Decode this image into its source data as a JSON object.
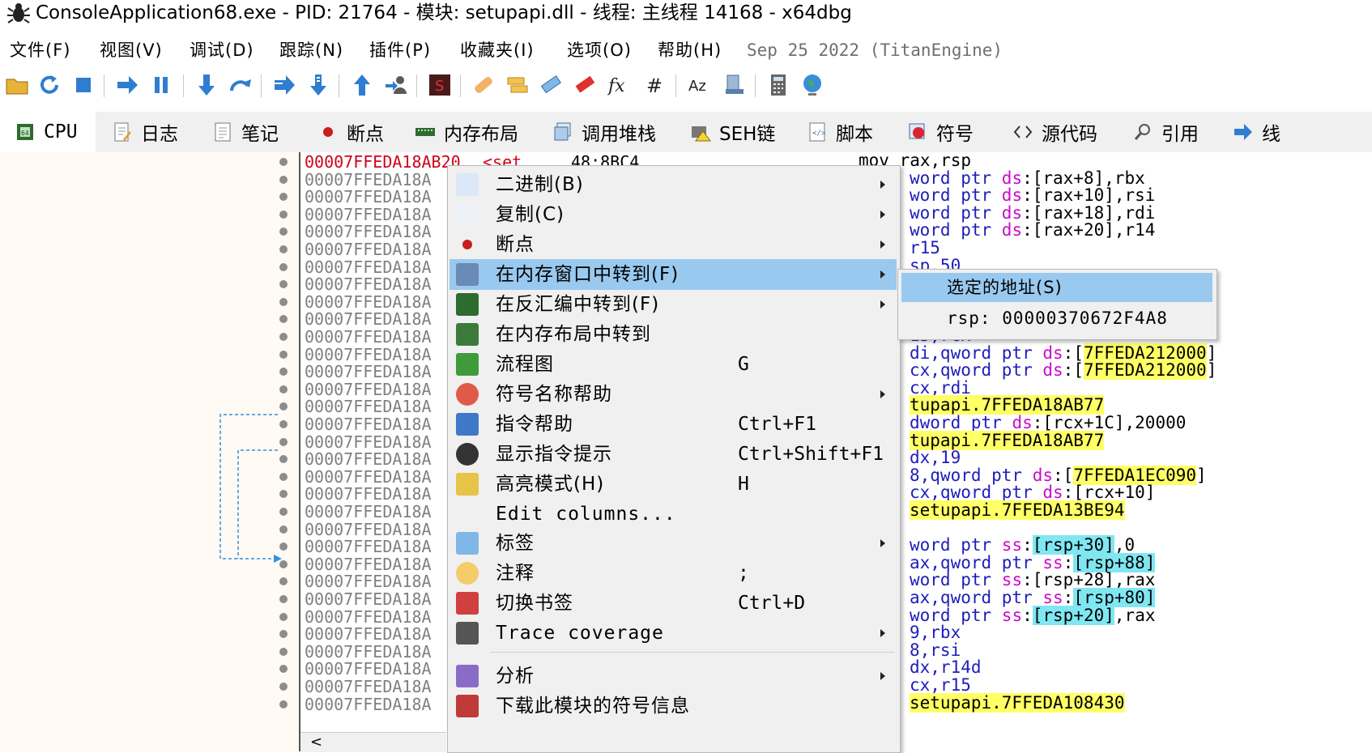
{
  "window": {
    "title": "ConsoleApplication68.exe - PID: 21764 - 模块: setupapi.dll - 线程: 主线程 14168 - x64dbg",
    "app_icon": "bug-icon"
  },
  "menubar": {
    "items": [
      "文件(F)",
      "视图(V)",
      "调试(D)",
      "跟踪(N)",
      "插件(P)",
      "收藏夹(I)",
      "选项(O)",
      "帮助(H)"
    ],
    "build_info": "Sep 25 2022 (TitanEngine)"
  },
  "toolbar": {
    "icons": [
      "open-icon",
      "restart-icon",
      "stop-icon",
      "run-icon",
      "pause-icon",
      "step-into-icon",
      "step-over-icon",
      "trace-into-icon",
      "trace-over-icon",
      "execute-till-return-icon",
      "run-to-user-code-icon",
      "scylla-icon",
      "patch-icon",
      "comment-icon",
      "label-icon",
      "bookmark-icon",
      "function-icon",
      "hash-icon",
      "font-icon",
      "calculator-icon",
      "memory-icon",
      "globe-icon"
    ]
  },
  "tabs": [
    {
      "label": "CPU",
      "icon": "cpu-icon",
      "active": true
    },
    {
      "label": "日志",
      "icon": "log-icon"
    },
    {
      "label": "笔记",
      "icon": "notes-icon"
    },
    {
      "label": "断点",
      "icon": "breakpoint-icon"
    },
    {
      "label": "内存布局",
      "icon": "memory-map-icon"
    },
    {
      "label": "调用堆栈",
      "icon": "call-stack-icon"
    },
    {
      "label": "SEH链",
      "icon": "seh-icon"
    },
    {
      "label": "脚本",
      "icon": "script-icon"
    },
    {
      "label": "符号",
      "icon": "symbols-icon"
    },
    {
      "label": "源代码",
      "icon": "source-icon"
    },
    {
      "label": "引用",
      "icon": "references-icon"
    },
    {
      "label": "线",
      "icon": "threads-icon"
    }
  ],
  "disasm": {
    "first_row": {
      "addr": "00007FFEDA18AB20",
      "label": "<set",
      "bytes": "48:8BC4",
      "instr": "mov rax,rsp"
    },
    "row_addr_prefix": "00007FFEDA18A",
    "visible_instr": [
      {
        "pre": "word ptr ",
        "seg": "ds",
        "post": ":[rax+8],rbx"
      },
      {
        "pre": "word ptr ",
        "seg": "ds",
        "post": ":[rax+10],rsi"
      },
      {
        "pre": "word ptr ",
        "seg": "ds",
        "post": ":[rax+18],rdi"
      },
      {
        "pre": "word ptr ",
        "seg": "ds",
        "post": ":[rax+20],r14"
      },
      {
        "pre": "r15"
      },
      {
        "pre": "sp,50"
      },
      {
        "pre": ""
      },
      {
        "pre": ""
      },
      {
        "pre": ""
      },
      {
        "pre": "15,rcx"
      },
      {
        "pre": "di,qword ptr ",
        "seg": "ds",
        "post": ":[",
        "hl": "7FFEDA212000",
        "tail": "]"
      },
      {
        "pre": "cx,qword ptr ",
        "seg": "ds",
        "post": ":[",
        "hl": "7FFEDA212000",
        "tail": "]"
      },
      {
        "pre": "cx,rdi"
      },
      {
        "hl": "tupapi.7FFEDA18AB77"
      },
      {
        "pre": "dword ptr ",
        "seg": "ds",
        "post": ":[rcx+1C],20000"
      },
      {
        "hl": "tupapi.7FFEDA18AB77"
      },
      {
        "pre": "dx,19"
      },
      {
        "pre": "8,qword ptr ",
        "seg": "ds",
        "post": ":[",
        "hl": "7FFEDA1EC090",
        "tail": "]"
      },
      {
        "pre": "cx,qword ptr ",
        "seg": "ds",
        "post": ":[rcx+10]"
      },
      {
        "hl": "setupapi.7FFEDA13BE94"
      },
      {
        "pre": ""
      },
      {
        "pre": "word ptr ",
        "seg": "ss",
        "post": ":",
        "bx": "[rsp+30]",
        "tail": ",0"
      },
      {
        "pre": "ax,qword ptr ",
        "seg": "ss",
        "post": ":",
        "bx": "[rsp+88]"
      },
      {
        "pre": "word ptr ",
        "seg": "ss",
        "post": ":[rsp+28],rax"
      },
      {
        "pre": "ax,qword ptr ",
        "seg": "ss",
        "post": ":",
        "bx": "[rsp+80]"
      },
      {
        "pre": "word ptr ",
        "seg": "ss",
        "post": ":",
        "bx": "[rsp+20]",
        "tail": ",rax"
      },
      {
        "pre": "9,rbx"
      },
      {
        "pre": "8,rsi"
      },
      {
        "pre": "dx,r14d"
      },
      {
        "pre": "cx,r15"
      },
      {
        "hl": "setupapi.7FFEDA108430"
      }
    ]
  },
  "context_menu": {
    "items": [
      {
        "label": "二进制(B)",
        "icon": "binary-icon",
        "submenu": true
      },
      {
        "label": "复制(C)",
        "icon": "copy-icon",
        "submenu": true
      },
      {
        "label": "断点",
        "icon": "breakpoint-dot-icon",
        "submenu": true
      },
      {
        "label": "在内存窗口中转到(F)",
        "icon": "memory-window-icon",
        "submenu": true,
        "selected": true
      },
      {
        "label": "在反汇编中转到(F)",
        "icon": "cpu-chip-icon",
        "submenu": true
      },
      {
        "label": "在内存布局中转到",
        "icon": "memory-layout-icon"
      },
      {
        "label": "流程图",
        "icon": "tree-icon",
        "shortcut": "G"
      },
      {
        "label": "符号名称帮助",
        "icon": "lifebuoy-icon",
        "submenu": true
      },
      {
        "label": "指令帮助",
        "icon": "help-book-icon",
        "shortcut": "Ctrl+F1"
      },
      {
        "label": "显示指令提示",
        "icon": "penguin-icon",
        "shortcut": "Ctrl+Shift+F1"
      },
      {
        "label": "高亮模式(H)",
        "icon": "highlighter-icon",
        "shortcut": "H"
      },
      {
        "label": "Edit columns...",
        "icon": ""
      },
      {
        "label": "标签",
        "icon": "tag-add-icon",
        "submenu": true
      },
      {
        "label": "注释",
        "icon": "comment-bubble-icon",
        "shortcut": ";"
      },
      {
        "label": "切换书签",
        "icon": "bookmark-house-icon",
        "shortcut": "Ctrl+D"
      },
      {
        "label": "Trace coverage",
        "icon": "footprints-icon",
        "submenu": true
      },
      {
        "label": "分析",
        "icon": "magic-wand-icon",
        "submenu": true
      },
      {
        "label": "下载此模块的符号信息",
        "icon": "download-symbols-icon"
      }
    ]
  },
  "submenu": {
    "items": [
      {
        "label": "选定的地址(S)",
        "selected": true
      },
      {
        "label": "rsp: 00000370672F4A8"
      }
    ]
  },
  "scroll": {
    "left_arrow": "<"
  },
  "colors": {
    "selection": "#99c9ef",
    "highlight": "#ffff66",
    "bracket": "#7fe7f2",
    "segment": "#cc0acc",
    "first_addr": "#d0021b"
  }
}
